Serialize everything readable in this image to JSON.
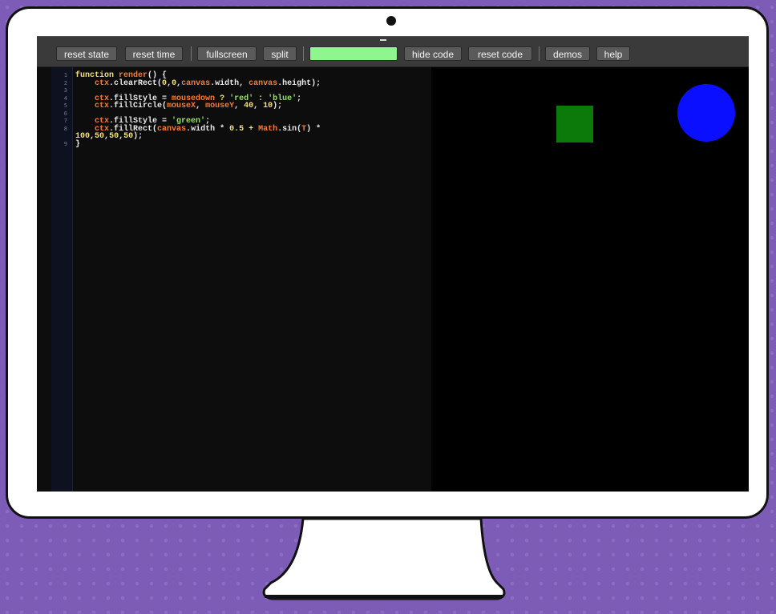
{
  "toolbar": {
    "buttons": [
      "reset state",
      "reset time",
      "fullscreen",
      "split",
      "",
      "hide code",
      "reset code",
      "demos",
      "help"
    ]
  },
  "editor": {
    "line_numbers": [
      "1",
      "2",
      "3",
      "4",
      "5",
      "6",
      "7",
      "8",
      "",
      "9"
    ],
    "lines": [
      [
        [
          "kw",
          "function "
        ],
        [
          "fn",
          "render"
        ],
        [
          "",
          "() {"
        ]
      ],
      [
        [
          "",
          "    "
        ],
        [
          "fn",
          "ctx"
        ],
        [
          "",
          ".clearRect("
        ],
        [
          "num",
          "0"
        ],
        [
          "",
          ","
        ],
        [
          "num",
          "0"
        ],
        [
          "",
          ","
        ],
        [
          "fn",
          "canvas"
        ],
        [
          "",
          ".width, "
        ],
        [
          "fn",
          "canvas"
        ],
        [
          "",
          ".height);"
        ]
      ],
      [
        [
          "",
          ""
        ]
      ],
      [
        [
          "",
          "    "
        ],
        [
          "fn",
          "ctx"
        ],
        [
          "",
          ".fillStyle = "
        ],
        [
          "fn",
          "mousedown"
        ],
        [
          "kw",
          " ? "
        ],
        [
          "str",
          "'red'"
        ],
        [
          "kw",
          " : "
        ],
        [
          "str",
          "'blue'"
        ],
        [
          "",
          ";"
        ]
      ],
      [
        [
          "",
          "    "
        ],
        [
          "fn",
          "ctx"
        ],
        [
          "",
          ".fillCircle("
        ],
        [
          "fn",
          "mouseX"
        ],
        [
          "",
          ", "
        ],
        [
          "fn",
          "mouseY"
        ],
        [
          "",
          ", "
        ],
        [
          "num",
          "40"
        ],
        [
          "",
          ", "
        ],
        [
          "num",
          "10"
        ],
        [
          "",
          ");"
        ]
      ],
      [
        [
          "",
          ""
        ]
      ],
      [
        [
          "",
          "    "
        ],
        [
          "fn",
          "ctx"
        ],
        [
          "",
          ".fillStyle = "
        ],
        [
          "str",
          "'green'"
        ],
        [
          "",
          ";"
        ]
      ],
      [
        [
          "",
          "    "
        ],
        [
          "fn",
          "ctx"
        ],
        [
          "",
          ".fillRect("
        ],
        [
          "fn",
          "canvas"
        ],
        [
          "",
          ".width * "
        ],
        [
          "num",
          "0.5"
        ],
        [
          "kw",
          " + "
        ],
        [
          "fn",
          "Math"
        ],
        [
          "",
          ".sin("
        ],
        [
          "fn",
          "T"
        ],
        [
          "",
          ") *"
        ]
      ],
      [
        [
          "num",
          "100"
        ],
        [
          "",
          ","
        ],
        [
          "num",
          "50"
        ],
        [
          "",
          ","
        ],
        [
          "num",
          "50"
        ],
        [
          "",
          ","
        ],
        [
          "num",
          "50"
        ],
        [
          "",
          ");"
        ]
      ],
      [
        [
          "",
          "}"
        ]
      ]
    ]
  },
  "canvas": {
    "square_color": "#0b7a0b",
    "circle_color": "#0a10ff"
  }
}
